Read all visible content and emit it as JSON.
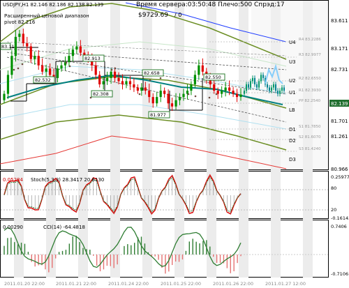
{
  "header": {
    "symbol_quotes": "USDJPY,H1  82.146 82.186 82.138 82.139",
    "line2": "Время сервера:03:50:48 Плечо:500 Спрэд:17",
    "line3": "Расширенный ценовой диапазон",
    "line4": "pivot 82.216",
    "equity": "$9729.69",
    "percent": "/ 0"
  },
  "price_axis": {
    "ticks": [
      "83.611",
      "83.171",
      "82.731",
      "82.139",
      "81.701",
      "81.261",
      "80.966"
    ],
    "current_price": "82.139"
  },
  "pivot_labels": {
    "letters": [
      "U4",
      "U3",
      "U2",
      "U1",
      "LB",
      "D1",
      "D2",
      "D3"
    ],
    "levels": [
      "R4 83.2286",
      "R3 82.9977",
      "R2 82.6550",
      "R1 82.3930",
      "PP 82.2540",
      "S1 81.7850",
      "S2 81.6070",
      "S3 81.4240"
    ]
  },
  "price_boxes": [
    "83.11",
    "82.532",
    "82.913",
    "82.308",
    "82.658",
    "82.550",
    "81.977"
  ],
  "stoch": {
    "label": "Stoch(5,3,3) 28.3417 20.6130",
    "left_value": "0.05284",
    "axis": [
      "0.25977",
      "80",
      "20",
      "-0.16143"
    ]
  },
  "cci": {
    "label": "CCI(14) -64.4818",
    "left_value": "0.00290",
    "axis": [
      "0.7406",
      "-0.7106"
    ]
  },
  "time_axis": [
    "2011.01.20 22:00",
    "2011.01.21 22:00",
    "2011.01.24 22:00",
    "2011.01.25 22:00",
    "2011.01.26 22:00",
    "2011.01.27 12:00"
  ],
  "colors": {
    "bull": "#009000",
    "bear": "#e00000",
    "channel_green": "#6b8e23",
    "ma_teal": "#008080",
    "forecast": "#87cefa",
    "cci_line": "#2e7d32"
  },
  "chart_data": {
    "type": "candlestick",
    "symbol": "USDJPY",
    "timeframe": "H1",
    "y_range": [
      80.966,
      83.611
    ],
    "closes": [
      82.15,
      82.45,
      82.75,
      83.05,
      83.1,
      82.95,
      82.9,
      82.7,
      82.75,
      82.6,
      82.5,
      82.55,
      82.45,
      82.4,
      82.55,
      82.6,
      82.65,
      82.75,
      82.85,
      82.9,
      82.8,
      82.75,
      82.7,
      82.6,
      82.45,
      82.3,
      82.35,
      82.4,
      82.5,
      82.4,
      82.35,
      82.3,
      82.35,
      82.3,
      82.25,
      82.2,
      82.25,
      82.2,
      82.1,
      82.0,
      82.1,
      82.2,
      82.15,
      82.0,
      81.95,
      82.05,
      82.1,
      82.15,
      82.2,
      82.3,
      82.45,
      82.6,
      82.5,
      82.4,
      82.3,
      82.2,
      82.15,
      82.2,
      82.25,
      82.2,
      82.15,
      82.1,
      82.14
    ]
  }
}
